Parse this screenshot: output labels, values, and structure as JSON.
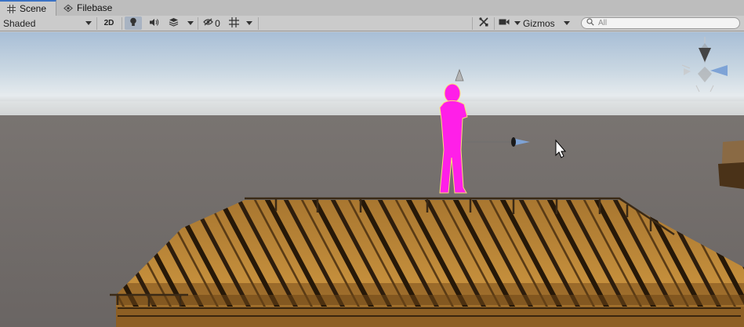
{
  "tabs": [
    {
      "label": "Scene",
      "icon": "grid-icon",
      "active": true
    },
    {
      "label": "Filebase",
      "icon": "eye-hierarchy-icon",
      "active": false
    }
  ],
  "toolbar": {
    "shading_mode": "Shaded",
    "mode_2d": "2D",
    "hidden_count": "0",
    "gizmos_label": "Gizmos",
    "search_placeholder": "All"
  },
  "colors": {
    "selection_accent": "#3a72c5",
    "character": "#ff1fe8",
    "deck": "#b07a2e",
    "sky_top": "#a7bdd3",
    "ground": "#6f6b68"
  }
}
